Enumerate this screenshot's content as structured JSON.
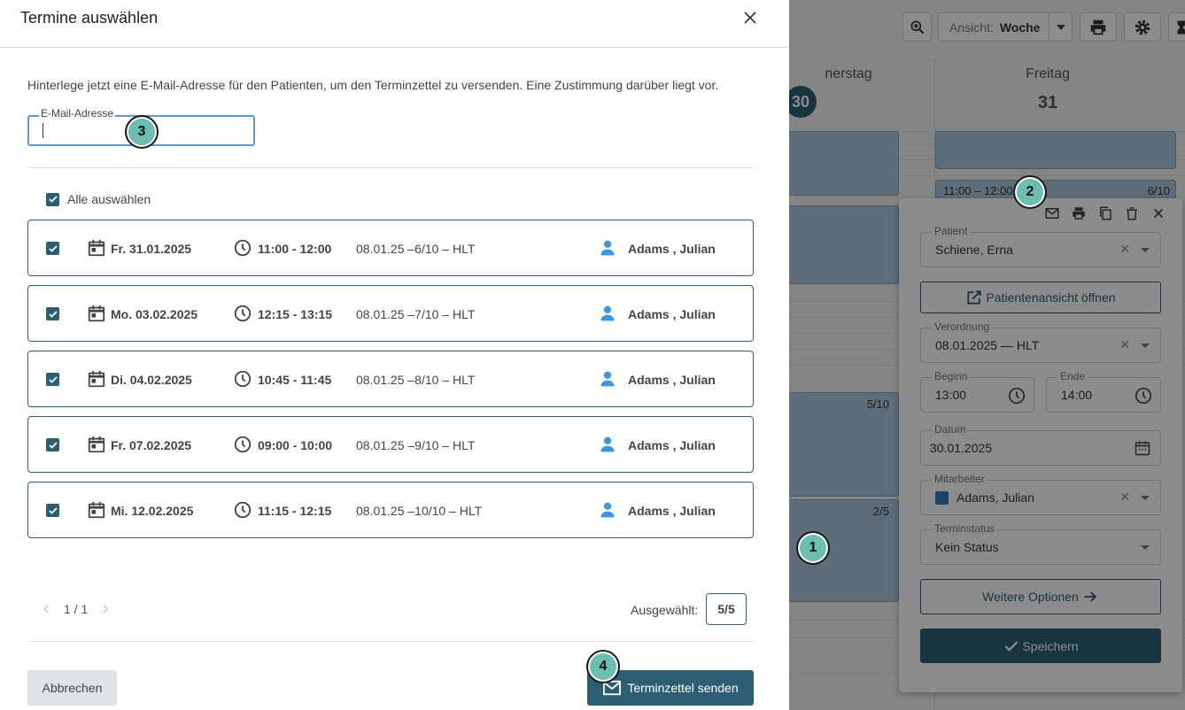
{
  "dialog": {
    "title": "Termine auswählen",
    "info": "Hinterlege jetzt eine E-Mail-Adresse für den Patienten, um den Terminzettel zu versenden. Eine Zustimmung darüber liegt vor.",
    "email": {
      "label": "E-Mail-Adresse",
      "value": "",
      "placeholder": ""
    },
    "select_all_label": "Alle auswählen",
    "appointments": [
      {
        "date": "Fr. 31.01.2025",
        "time": "11:00 - 12:00",
        "ref": "08.01.25 –6/10 – HLT",
        "employee": "Adams , Julian",
        "checked": true
      },
      {
        "date": "Mo. 03.02.2025",
        "time": "12:15 - 13:15",
        "ref": "08.01.25 –7/10 – HLT",
        "employee": "Adams , Julian",
        "checked": true
      },
      {
        "date": "Di. 04.02.2025",
        "time": "10:45 - 11:45",
        "ref": "08.01.25 –8/10 – HLT",
        "employee": "Adams , Julian",
        "checked": true
      },
      {
        "date": "Fr. 07.02.2025",
        "time": "09:00 - 10:00",
        "ref": "08.01.25 –9/10 – HLT",
        "employee": "Adams , Julian",
        "checked": true
      },
      {
        "date": "Mi. 12.02.2025",
        "time": "11:15 - 12:15",
        "ref": "08.01.25 –10/10 – HLT",
        "employee": "Adams , Julian",
        "checked": true
      }
    ],
    "pagination": "1 / 1",
    "selected_label": "Ausgewählt:",
    "selected_count": "5/5",
    "cancel_label": "Abbrechen",
    "send_label": "Terminzettel senden"
  },
  "toolbar": {
    "view_label": "Ansicht:",
    "view_value": "Woche"
  },
  "calendar": {
    "days": [
      {
        "name": "nerstag",
        "num": "30"
      },
      {
        "name": "Freitag",
        "num": "31"
      }
    ],
    "events": [
      {
        "label": "11:00 – 12:00",
        "count": "6/10"
      },
      {
        "count": "5/10"
      },
      {
        "count": "2/5"
      }
    ]
  },
  "popup": {
    "patient": {
      "label": "Patient",
      "value": "Schiene, Erna"
    },
    "open_view_label": "Patientenansicht öffnen",
    "prescription": {
      "label": "Verordnung",
      "value": "08.01.2025 — HLT"
    },
    "start": {
      "label": "Beginn",
      "value": "13:00"
    },
    "end": {
      "label": "Ende",
      "value": "14:00"
    },
    "date": {
      "label": "Datum",
      "value": "30.01.2025"
    },
    "employee": {
      "label": "Mitarbeiter",
      "value": "Adams, Julian",
      "color": "#2f7fc1"
    },
    "status": {
      "label": "Terminstatus",
      "value": "Kein Status"
    },
    "more_label": "Weitere Optionen",
    "save_label": "Speichern"
  },
  "markers": [
    "1",
    "2",
    "3",
    "4"
  ],
  "colors": {
    "primary": "#2c5f73",
    "event": "#a9c7de",
    "marker": "#6cbfb0",
    "focus": "#5b9bd5"
  }
}
